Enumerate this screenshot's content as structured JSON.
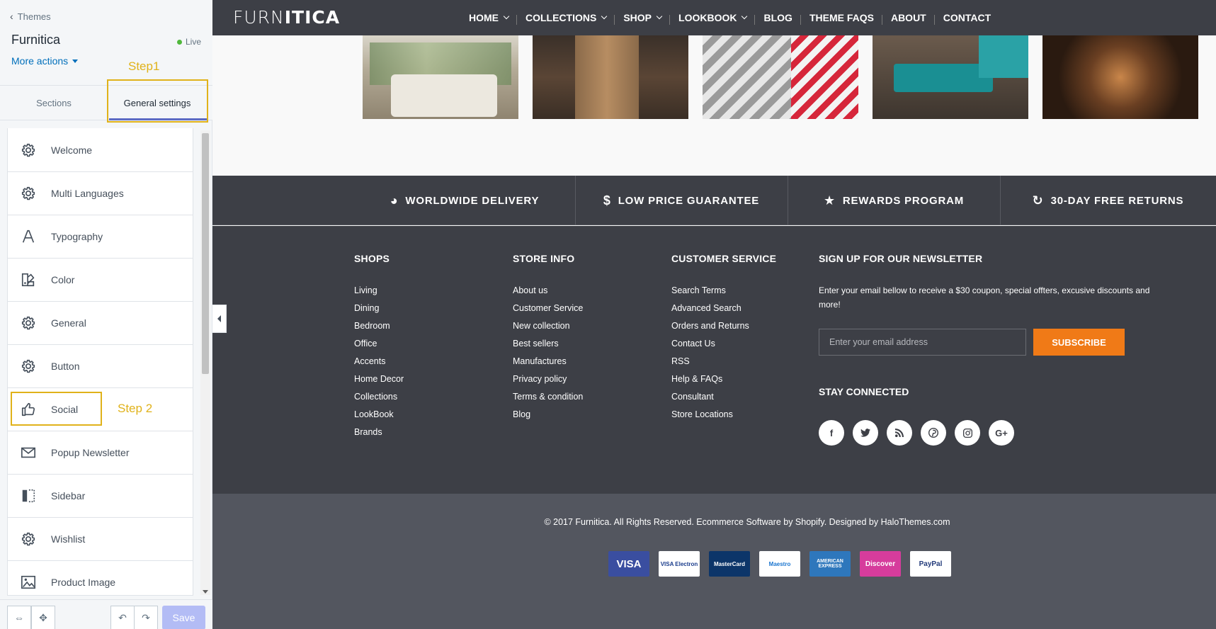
{
  "sidebar": {
    "back_label": "Themes",
    "theme_name": "Furnitica",
    "status": "Live",
    "more_actions": "More actions",
    "step1": "Step1",
    "step2": "Step 2",
    "tabs": [
      "Sections",
      "General settings"
    ],
    "items": [
      {
        "label": "Welcome",
        "icon": "gear-icon"
      },
      {
        "label": "Multi Languages",
        "icon": "gear-icon"
      },
      {
        "label": "Typography",
        "icon": "typography-icon"
      },
      {
        "label": "Color",
        "icon": "color-icon"
      },
      {
        "label": "General",
        "icon": "gear-icon"
      },
      {
        "label": "Button",
        "icon": "gear-icon"
      },
      {
        "label": "Social",
        "icon": "thumbs-up-icon"
      },
      {
        "label": "Popup Newsletter",
        "icon": "envelope-icon"
      },
      {
        "label": "Sidebar",
        "icon": "sidebar-icon"
      },
      {
        "label": "Wishlist",
        "icon": "gear-icon"
      },
      {
        "label": "Product Image",
        "icon": "image-icon"
      }
    ],
    "save_label": "Save"
  },
  "preview": {
    "logo": {
      "part1": "FURN",
      "part2": "ITICA"
    },
    "nav": [
      {
        "label": "HOME",
        "dropdown": true
      },
      {
        "label": "COLLECTIONS",
        "dropdown": true
      },
      {
        "label": "SHOP",
        "dropdown": true
      },
      {
        "label": "LOOKBOOK",
        "dropdown": true
      },
      {
        "label": "BLOG",
        "dropdown": false
      },
      {
        "label": "THEME FAQS",
        "dropdown": false
      },
      {
        "label": "ABOUT",
        "dropdown": false
      },
      {
        "label": "CONTACT",
        "dropdown": false
      }
    ],
    "features": [
      {
        "label": "WORLDWIDE DELIVERY",
        "icon": "globe-icon"
      },
      {
        "label": "LOW PRICE GUARANTEE",
        "icon": "dollar-icon"
      },
      {
        "label": "REWARDS PROGRAM",
        "icon": "star-icon"
      },
      {
        "label": "30-DAY FREE RETURNS",
        "icon": "refresh-icon"
      }
    ],
    "footer": {
      "shops": {
        "title": "SHOPS",
        "links": [
          "Living",
          "Dining",
          "Bedroom",
          "Office",
          "Accents",
          "Home Decor",
          "Collections",
          "LookBook",
          "Brands"
        ]
      },
      "store_info": {
        "title": "STORE INFO",
        "links": [
          "About us",
          "Customer Service",
          "New collection",
          "Best sellers",
          "Manufactures",
          "Privacy policy",
          "Terms & condition",
          "Blog"
        ]
      },
      "customer_service": {
        "title": "CUSTOMER SERVICE",
        "links": [
          "Search Terms",
          "Advanced Search",
          "Orders and Returns",
          "Contact Us",
          "RSS",
          "Help & FAQs",
          "Consultant",
          "Store Locations"
        ]
      },
      "newsletter": {
        "title": "SIGN UP FOR OUR NEWSLETTER",
        "text": "Enter your email bellow to receive a $30 coupon, special offters, excusive discounts and more!",
        "placeholder": "Enter your email address",
        "button": "SUBSCRIBE",
        "stay_connected": "STAY CONNECTED",
        "socials": [
          "facebook-icon",
          "twitter-icon",
          "rss-icon",
          "pinterest-icon",
          "instagram-icon",
          "google-plus-icon"
        ]
      },
      "copyright": "© 2017 Furnitica. All Rights Reserved. Ecommerce Software by Shopify. Designed by HaloThemes.com",
      "payments": [
        {
          "name": "VISA",
          "bg": "#3a4ea0",
          "fg": "#ffffff"
        },
        {
          "name": "VISA Electron",
          "bg": "#ffffff",
          "fg": "#1a3c8c"
        },
        {
          "name": "MasterCard",
          "bg": "#0c3569",
          "fg": "#ffffff"
        },
        {
          "name": "Maestro",
          "bg": "#ffffff",
          "fg": "#1a75cf"
        },
        {
          "name": "AMERICAN EXPRESS",
          "bg": "#2e77bc",
          "fg": "#ffffff"
        },
        {
          "name": "Discover",
          "bg": "#d63c9c",
          "fg": "#ffffff"
        },
        {
          "name": "PayPal",
          "bg": "#ffffff",
          "fg": "#223a7a"
        }
      ]
    }
  },
  "colors": {
    "accent": "#f07a17",
    "header_bg": "#3d3f46",
    "highlight": "#e0b21a",
    "tab_underline": "#5c6ac4"
  }
}
